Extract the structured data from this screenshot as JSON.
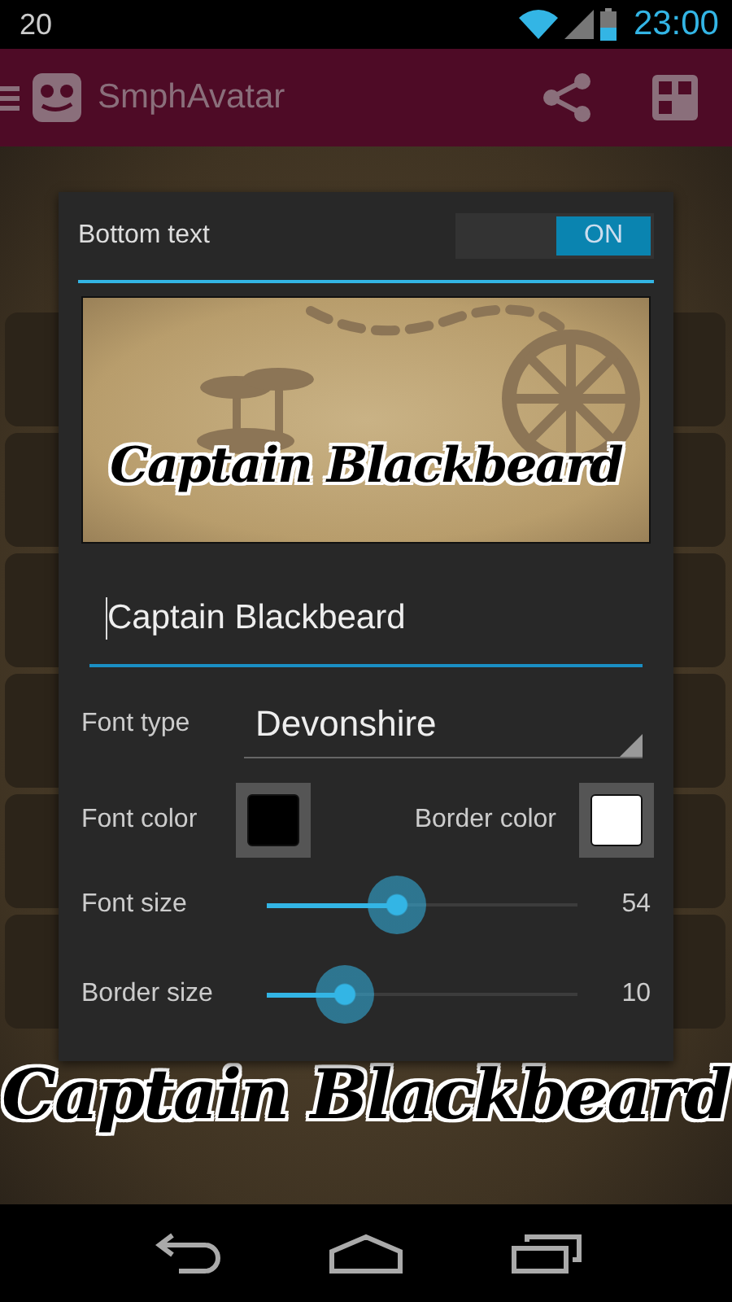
{
  "status_bar": {
    "notification": "20",
    "time": "23:00"
  },
  "app_bar": {
    "title": "SmphAvatar"
  },
  "background": {
    "caption": "Captain Blackbeard"
  },
  "dialog": {
    "title": "Bottom text",
    "switch": {
      "label": "ON",
      "on": true
    },
    "preview": {
      "caption": "Captain Blackbeard"
    },
    "text_field": {
      "value": "Captain Blackbeard"
    },
    "font_type": {
      "label": "Font type",
      "value": "Devonshire"
    },
    "colors": [
      {
        "label": "Font color",
        "color": "#000000"
      },
      {
        "label": "Border color",
        "color": "#ffffff"
      }
    ],
    "sliders": [
      {
        "label": "Font size",
        "level": 0.42,
        "reading": "54"
      },
      {
        "label": "Border size",
        "level": 0.25,
        "reading": "10"
      }
    ]
  }
}
